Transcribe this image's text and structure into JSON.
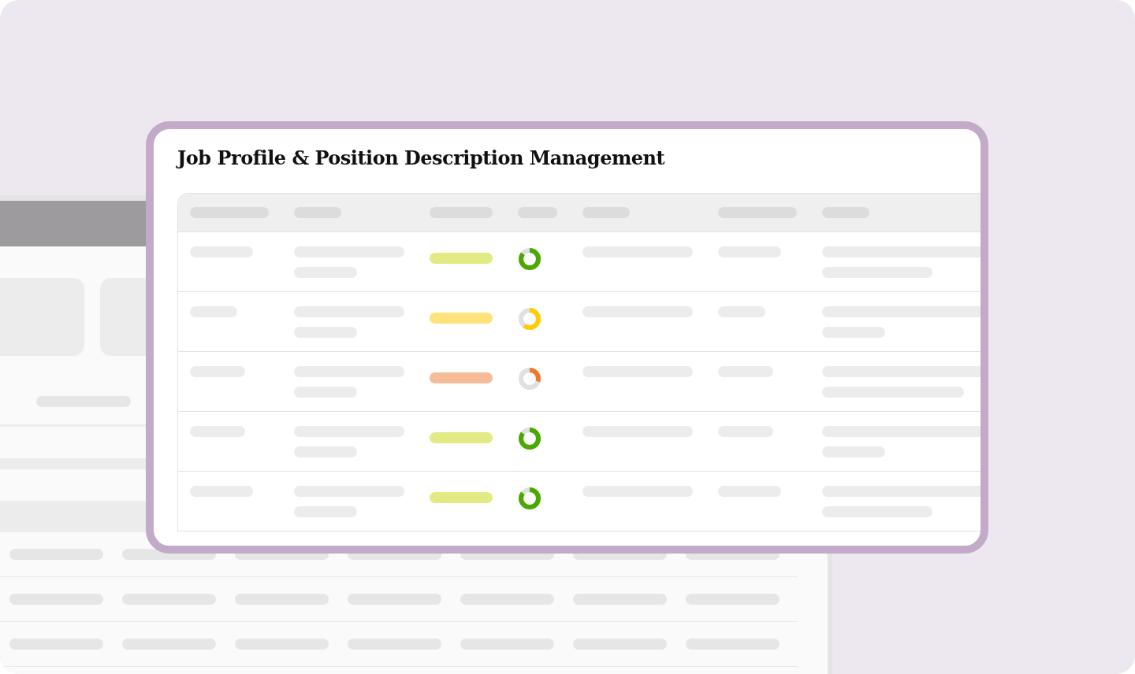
{
  "title": "Job Profile & Position Description Management",
  "rows": [
    {
      "status": {
        "color": "#e2ea84"
      },
      "progress": {
        "level": 0.85,
        "color": "#4aa800"
      }
    },
    {
      "status": {
        "color": "#ffe27a"
      },
      "progress": {
        "level": 0.6,
        "color": "#ffcc00"
      }
    },
    {
      "status": {
        "color": "#f6bb97"
      },
      "progress": {
        "level": 0.3,
        "color": "#f07830"
      }
    },
    {
      "status": {
        "color": "#e2ea84"
      },
      "progress": {
        "level": 0.85,
        "color": "#4aa800"
      }
    },
    {
      "status": {
        "color": "#e2ea84"
      },
      "progress": {
        "level": 0.85,
        "color": "#4aa800"
      }
    }
  ]
}
